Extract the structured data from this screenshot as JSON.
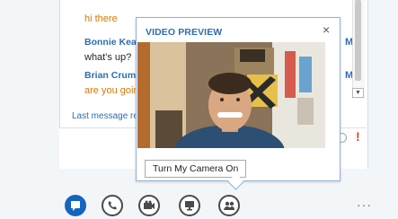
{
  "conversation": {
    "messages": [
      {
        "sender": "",
        "text": "hi there",
        "color": "#d8780a"
      },
      {
        "sender": "Bonnie Kearn",
        "text": "what's up?",
        "color": "#262626"
      },
      {
        "sender": "Brian Crum",
        "text": "are you goin",
        "color": "#d8780a"
      }
    ],
    "side_marks": [
      "M",
      "M"
    ],
    "last_message_label": "Last message re"
  },
  "video_preview": {
    "title": "VIDEO PREVIEW",
    "close_glyph": "×",
    "camera_button_label": "Turn My Camera On"
  },
  "toolbar": {
    "buttons": [
      {
        "name": "im-button",
        "icon": "chat-bubble-icon",
        "active": true
      },
      {
        "name": "call-button",
        "icon": "phone-icon",
        "active": false
      },
      {
        "name": "video-button",
        "icon": "camera-icon",
        "active": false
      },
      {
        "name": "present-button",
        "icon": "monitor-icon",
        "active": false
      },
      {
        "name": "participants-button",
        "icon": "people-icon",
        "active": false
      }
    ],
    "more_label": "···"
  },
  "colors": {
    "accent": "#2d6db5",
    "active_button": "#1565c0",
    "alert": "#d8491f",
    "message_orange": "#d8780a"
  }
}
